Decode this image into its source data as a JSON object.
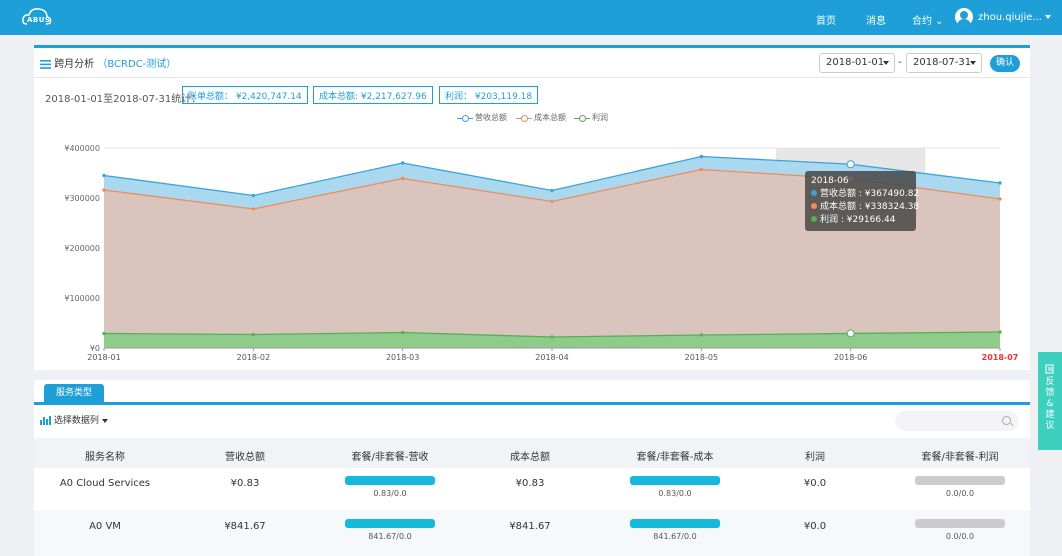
{
  "topbar": {
    "logo_text": "ABUS",
    "nav": [
      "首页",
      "消息",
      "合约 ⌄"
    ],
    "user": "zhou.qiujie...",
    "brand_color": "#1e9fd7"
  },
  "panel": {
    "title": "跨月分析",
    "account": "（BCRDC-测试）",
    "start_date": "2018-01-01",
    "end_date": "2018-07-31",
    "date_separator": "-",
    "confirm": "确认"
  },
  "summary": {
    "range_label": "2018-01-01至2018-07-31统计：",
    "bill_total": "账单总额： ¥2,420,747.14",
    "cost_total": "成本总额: ¥2,217,627.96",
    "profit_total": "利润： ¥203,119.18"
  },
  "chart_data": {
    "type": "area",
    "x": [
      "2018-01",
      "2018-02",
      "2018-03",
      "2018-04",
      "2018-05",
      "2018-06",
      "2018-07"
    ],
    "highlight_x": "2018-07",
    "y_ticks": [
      "¥0",
      "¥100000",
      "¥200000",
      "¥300000",
      "¥400000"
    ],
    "ylim": [
      0,
      400000
    ],
    "legend_position": "top-center",
    "grid": true,
    "series": [
      {
        "name": "营收总额",
        "color": "#3ba3d9",
        "fill": "#a9d8ef",
        "values": [
          345000,
          305000,
          370000,
          315000,
          383000,
          367490.82,
          330000
        ]
      },
      {
        "name": "成本总额",
        "color": "#ee8c5c",
        "fill": "#d9c5be",
        "values": [
          316000,
          278000,
          339000,
          293000,
          357000,
          338324.38,
          298000
        ]
      },
      {
        "name": "利润",
        "color": "#54b054",
        "fill": "#8fcc8a",
        "values": [
          29000,
          27000,
          31000,
          22000,
          26000,
          29166.44,
          32000
        ]
      }
    ],
    "tooltip": {
      "title": "2018-06",
      "lines": [
        "营收总额 : ¥367490.82",
        "成本总额 : ¥338324.38",
        "利润 : ¥29166.44"
      ]
    }
  },
  "table_section": {
    "tab": "服务类型",
    "chooser": "选择数据列",
    "search_placeholder": "",
    "columns": [
      "服务名称",
      "营收总额",
      "套餐/非套餐-营收",
      "成本总额",
      "套餐/非套餐-成本",
      "利润",
      "套餐/非套餐-利润"
    ],
    "rows": [
      {
        "name": "A0 Cloud Services",
        "revenue": "¥0.83",
        "rev_split": "0.83/0.0",
        "cost": "¥0.83",
        "cost_split": "0.83/0.0",
        "profit": "¥0.0",
        "profit_split": "0.0/0.0"
      },
      {
        "name": "A0 VM",
        "revenue": "¥841.67",
        "rev_split": "841.67/0.0",
        "cost": "¥841.67",
        "cost_split": "841.67/0.0",
        "profit": "¥0.0",
        "profit_split": "0.0/0.0"
      }
    ]
  },
  "feedback": [
    "反",
    "馈",
    "&",
    "建",
    "议"
  ]
}
